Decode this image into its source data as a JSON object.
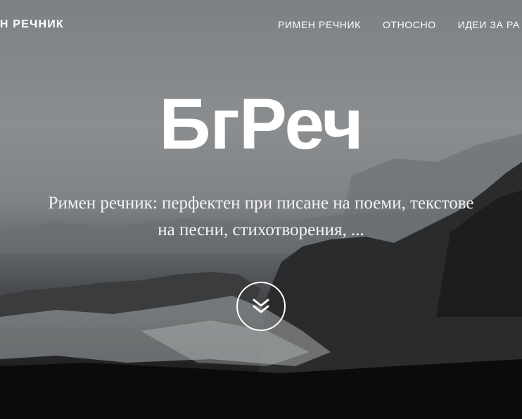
{
  "nav": {
    "brand": "ЕН РЕЧНИК",
    "links": [
      "РИМЕН РЕЧНИК",
      "ОТНОСНО",
      "ИДЕИ ЗА РА"
    ]
  },
  "hero": {
    "title": "БгРеч",
    "subtitle_line1": "Римен речник: перфектен при писане на поеми, текстове",
    "subtitle_line2": "на песни, стихотворения, ...",
    "scroll_icon": "double-chevron-down-icon"
  },
  "colors": {
    "text": "#ffffff",
    "sky": "#8a8e90",
    "dark": "#0c0c0d"
  }
}
